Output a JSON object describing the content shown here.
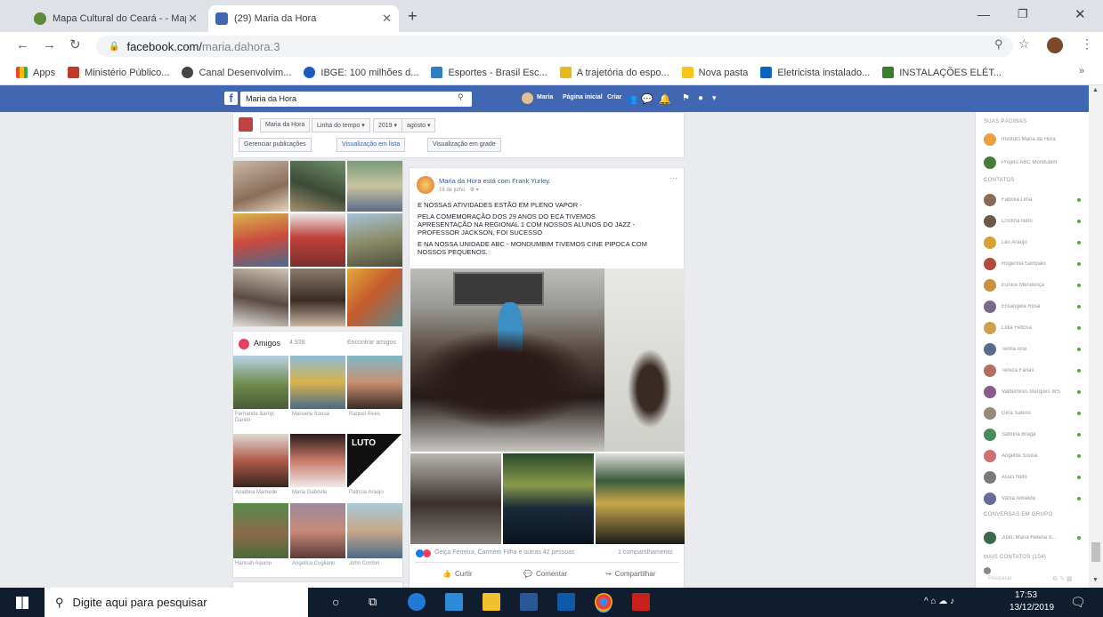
{
  "browser": {
    "tabs": [
      {
        "title": "Mapa Cultural do Ceará - - Mapa",
        "active": false
      },
      {
        "title": "(29) Maria da Hora",
        "active": true
      }
    ],
    "new_tab": "+",
    "url_host": "facebook.com/",
    "url_path": "maria.dahora.3",
    "bookmarks": [
      "Apps",
      "Ministério Público...",
      "Canal Desenvolvim...",
      "IBGE: 100 milhões d...",
      "Esportes - Brasil Esc...",
      "A trajetória do espo...",
      "Nova pasta",
      "Eletricista instalado...",
      "INSTALAÇÕES ELÉT..."
    ],
    "bookmarks_more": "»"
  },
  "fb": {
    "search_value": "Maria da Hora",
    "nav_user": "Maria",
    "nav_home": "Página inicial",
    "nav_create": "Criar",
    "timeline": {
      "selectors": [
        "Maria da Hora",
        "Linha do tempo ▾",
        "2019 ▾",
        "agosto ▾"
      ],
      "manage": "Gerenciar publicações",
      "list_view": "Visualização em lista",
      "grid_view": "Visualização em grade"
    },
    "friends": {
      "title": "Amigos",
      "count": "4.938",
      "find": "Encontrar amigos",
      "names": [
        "Fernanda &amp; Danilo",
        "Manuela Sousa",
        "Raquel Alves",
        "Anaíbea Mamede",
        "Maria Gabriele",
        "Patricia Araújo",
        "Hannah Aquino",
        "Angelica Cugliano",
        "John Cordon"
      ],
      "luto": "LUTO"
    },
    "post": {
      "author": "Maria da Hora está com Frank Yurley.",
      "date": "16 de julho · ⚙ ▾",
      "more": "···",
      "lines": [
        "E NOSSAS ATIVIDADES ESTÃO EM PLENO VAPOR -",
        "PELA COMEMORAÇÃO DOS 29 ANOS DO ECA TIVEMOS",
        "APRESENTAÇÃO NA REGIONAL 1 COM NOSSOS ALUNOS DO JAZZ -",
        "PROFESSOR JACKSON, FOI SUCESSO",
        "E NA NOSSA UNIDADE ABC - MONDUMBIM TIVEMOS CINE PIPOCA COM",
        "NOSSOS PEQUENOS."
      ],
      "reactions": "Gelça Ferreira, Carmem Filha e outras 42 pessoas",
      "shares": "1 compartilhamento",
      "actions": [
        "Curtir",
        "Comentar",
        "Compartilhar"
      ]
    },
    "chat": {
      "pages_header": "SUAS PÁGINAS",
      "pages": [
        "Instituto Maria da Hora",
        "Projeto ABC Mondubim"
      ],
      "contacts_header": "CONTATOS",
      "contacts": [
        "Fabiola Lima",
        "Cristina Neto",
        "Léo Araújo",
        "Rogerina Sampaio",
        "Eunice Mendonça",
        "Elisangela Rosa",
        "Lidia Feitosa",
        "Telma Aria",
        "Tereza Farias",
        "Valdemires Marques WS",
        "Gina Sabino",
        "Sabrina Braga",
        "Angelita Sousa",
        "Assis Neto",
        "Vania Almeida"
      ],
      "groups_header": "CONVERSAS EM GRUPO",
      "groups": [
        "Júlio, Maria Helena d..."
      ],
      "more_header": "MAIS CONTATOS (104)",
      "search_placeholder": "Pesquisar"
    }
  },
  "taskbar": {
    "search_placeholder": "Digite aqui para pesquisar",
    "time": "17:53",
    "date": "13/12/2019"
  },
  "colors": {
    "fb_blue": "#4267b2",
    "taskbar": "#101d2e",
    "online": "#42b72a"
  }
}
